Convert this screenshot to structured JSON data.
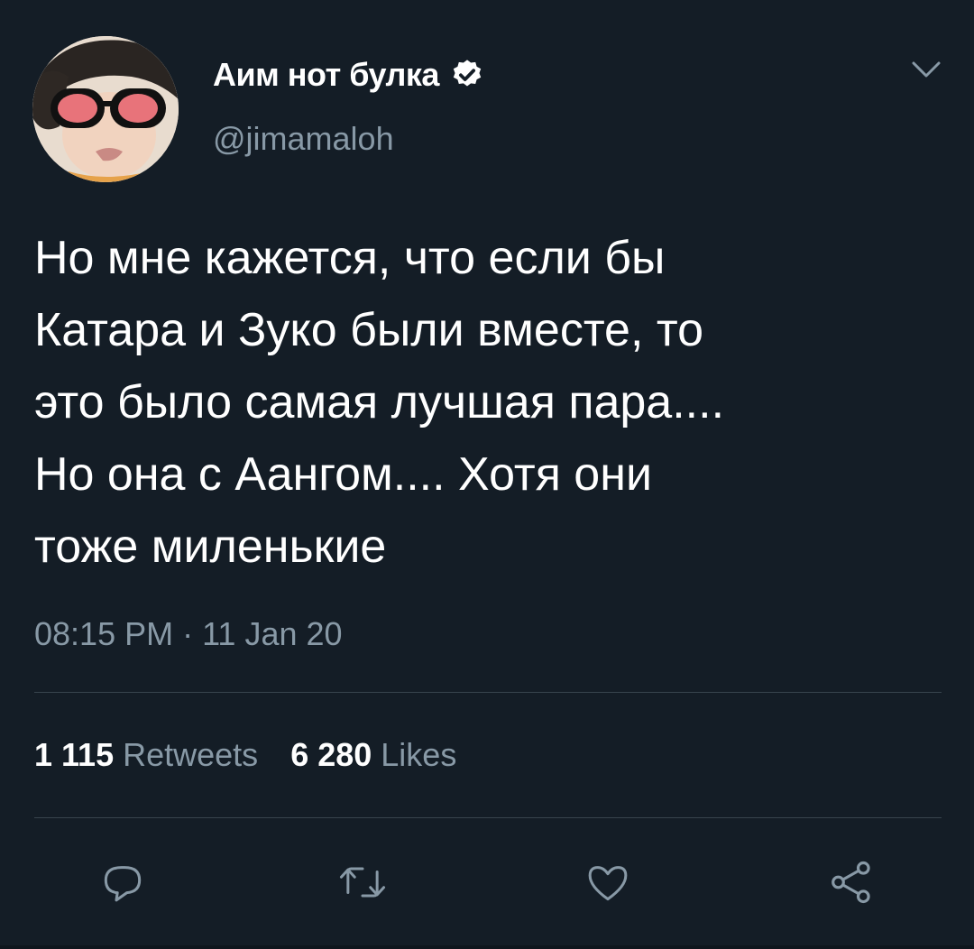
{
  "tweet": {
    "display_name": "Аим нот булка",
    "handle": "@jimamaloh",
    "text": "Но мне кажется, что если бы\nКатара и Зуко были вместе, то\nэто было самая лучшая пара....\nНо она с Аангом.... Хотя они\nтоже миленькие",
    "timestamp": "08:15 PM · 11 Jan 20",
    "retweets_count": "1 115",
    "retweets_label": "Retweets",
    "likes_count": "6 280",
    "likes_label": "Likes"
  },
  "colors": {
    "background": "#141d26",
    "secondary_text": "#8899a6",
    "divider": "#38444d",
    "verified_badge": "#ffffff"
  },
  "icons": {
    "verified": "verified-badge-icon",
    "menu": "chevron-down-icon",
    "reply": "reply-icon",
    "retweet": "retweet-icon",
    "like": "heart-icon",
    "share": "share-icon"
  }
}
